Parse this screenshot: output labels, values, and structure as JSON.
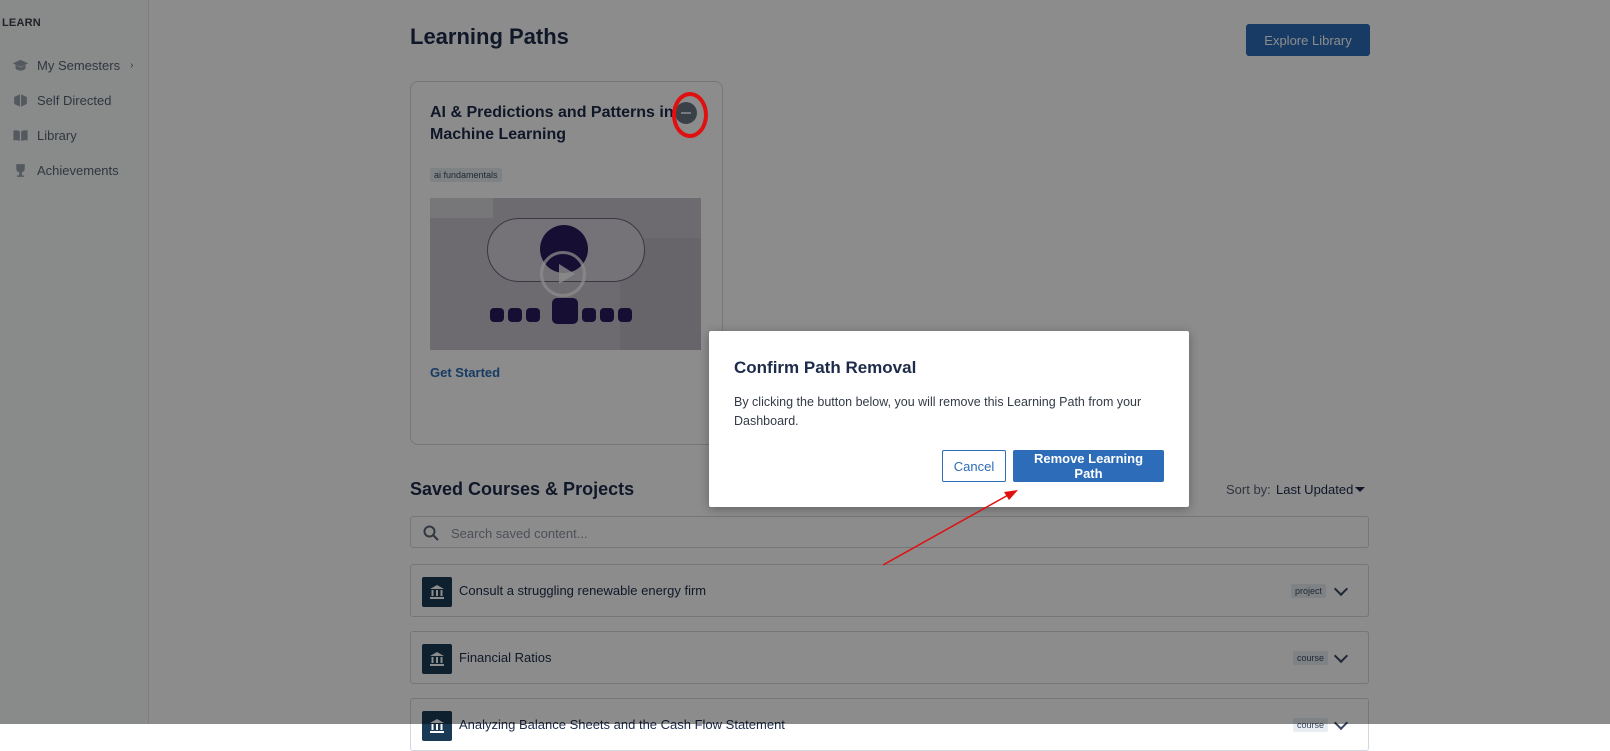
{
  "sidebar": {
    "section": "LEARN",
    "items": [
      {
        "label": "My Semesters",
        "icon": "graduation-cap-icon",
        "has_chevron": true,
        "chevron": "›"
      },
      {
        "label": "Self Directed",
        "icon": "box-icon"
      },
      {
        "label": "Library",
        "icon": "book-open-icon"
      },
      {
        "label": "Achievements",
        "icon": "trophy-icon"
      }
    ]
  },
  "header": {
    "title": "Learning Paths",
    "explore_label": "Explore Library"
  },
  "path_card": {
    "title": "AI & Predictions and Patterns in Machine Learning",
    "tag": "ai fundamentals",
    "cta": "Get Started"
  },
  "saved": {
    "title": "Saved Courses & Projects",
    "sort_label": "Sort by:",
    "sort_value": "Last Updated",
    "search_placeholder": "Search saved content...",
    "rows": [
      {
        "label": "Consult a struggling renewable energy firm",
        "tag": "project"
      },
      {
        "label": "Financial Ratios",
        "tag": "course"
      },
      {
        "label": "Analyzing Balance Sheets and the Cash Flow Statement",
        "tag": "course"
      }
    ]
  },
  "modal": {
    "title": "Confirm Path Removal",
    "body": "By clicking the button below, you will remove this Learning Path from your Dashboard.",
    "cancel_label": "Cancel",
    "remove_label": "Remove Learning Path"
  },
  "colors": {
    "accent": "#2c6cb8",
    "annotation": "#e01010",
    "overlay": "rgba(0,0,0,0.45)"
  }
}
